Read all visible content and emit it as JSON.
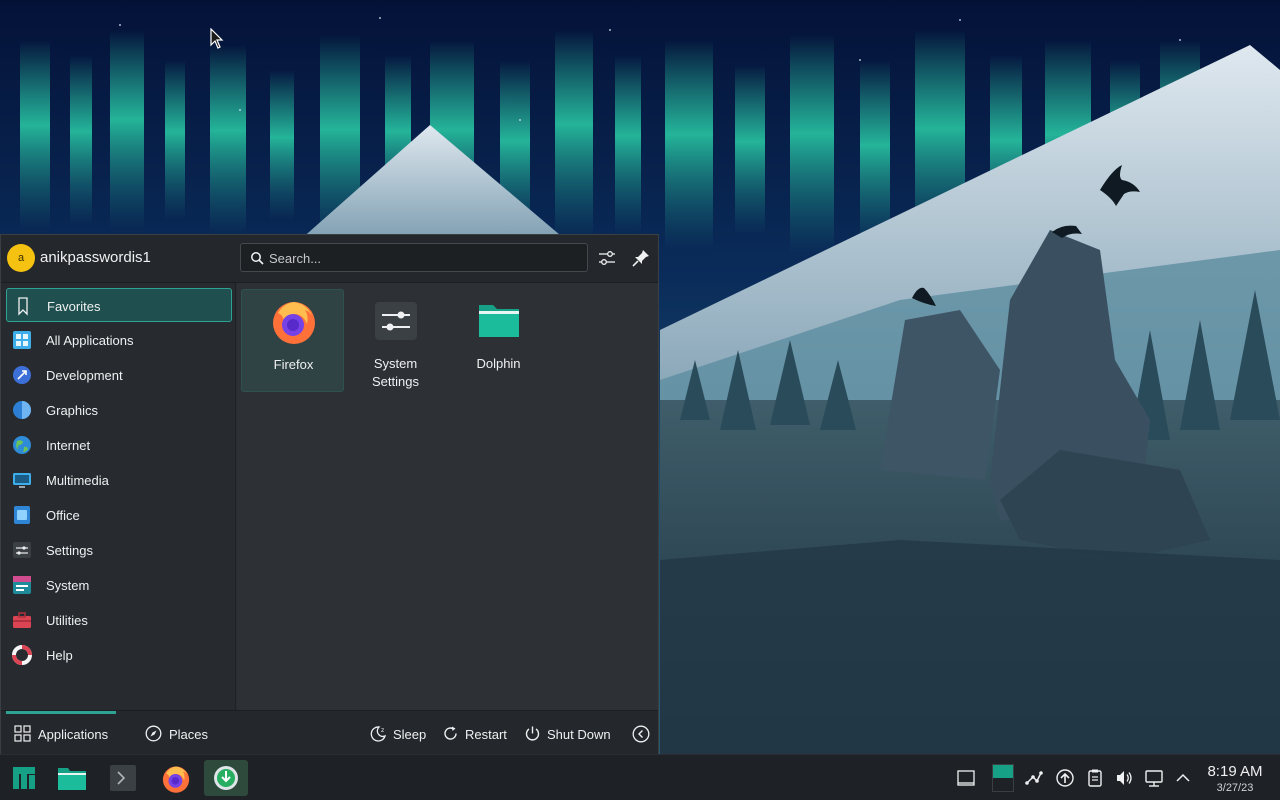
{
  "launcher": {
    "avatar_letter": "a",
    "username": "anikpasswordis1",
    "search": {
      "placeholder": "Search..."
    },
    "categories": [
      {
        "label": "Favorites",
        "icon": "bookmark-icon",
        "active": true
      },
      {
        "label": "All Applications",
        "icon": "grid-apps-icon"
      },
      {
        "label": "Development",
        "icon": "development-icon"
      },
      {
        "label": "Graphics",
        "icon": "graphics-icon"
      },
      {
        "label": "Internet",
        "icon": "internet-globe-icon"
      },
      {
        "label": "Multimedia",
        "icon": "multimedia-icon"
      },
      {
        "label": "Office",
        "icon": "office-icon"
      },
      {
        "label": "Settings",
        "icon": "settings-icon"
      },
      {
        "label": "System",
        "icon": "system-icon"
      },
      {
        "label": "Utilities",
        "icon": "utilities-toolbox-icon"
      },
      {
        "label": "Help",
        "icon": "help-lifebuoy-icon"
      }
    ],
    "favorites": [
      {
        "label": "Firefox",
        "icon": "firefox-icon"
      },
      {
        "label": "System Settings",
        "label_line1": "System",
        "label_line2": "Settings",
        "icon": "system-settings-icon"
      },
      {
        "label": "Dolphin",
        "icon": "dolphin-folder-icon"
      }
    ],
    "footer": {
      "tabs": [
        {
          "label": "Applications",
          "icon": "applications-grid-icon",
          "active": true
        },
        {
          "label": "Places",
          "icon": "compass-icon"
        }
      ],
      "power": [
        {
          "label": "Sleep",
          "icon": "sleep-icon"
        },
        {
          "label": "Restart",
          "icon": "restart-icon"
        },
        {
          "label": "Shut Down",
          "icon": "power-icon"
        }
      ],
      "more_icon": "chevron-left-circle-icon"
    }
  },
  "taskbar": {
    "items": [
      {
        "name": "manjaro-launcher",
        "icon": "manjaro-logo-icon"
      },
      {
        "name": "dolphin",
        "icon": "folder-icon"
      },
      {
        "name": "konsole",
        "icon": "terminal-icon"
      },
      {
        "name": "firefox",
        "icon": "firefox-icon"
      },
      {
        "name": "installer",
        "icon": "download-icon",
        "running": true
      }
    ],
    "tray": [
      "show-desktop-icon",
      "pager-icon",
      "network-share-icon",
      "updates-icon",
      "clipboard-icon",
      "volume-icon",
      "network-wired-icon",
      "expand-tray-icon"
    ],
    "clock": {
      "time": "8:19 AM",
      "date": "3/27/23"
    }
  },
  "colors": {
    "accent": "#2fa393",
    "panel": "#24272b",
    "launcher_bg": "#2a2e32",
    "aurora": "#2ee6b4"
  }
}
